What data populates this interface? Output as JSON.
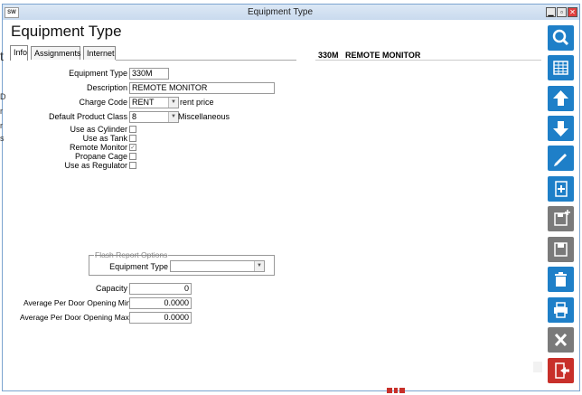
{
  "window": {
    "title": "Equipment Type",
    "app_icon": "SW"
  },
  "page": {
    "title": "Equipment Type"
  },
  "tabs": [
    {
      "label": "Info"
    },
    {
      "label": "Assignments"
    },
    {
      "label": "Internet"
    }
  ],
  "form": {
    "equipment_type": {
      "label": "Equipment Type",
      "value": "330M"
    },
    "description": {
      "label": "Description",
      "value": "REMOTE MONITOR"
    },
    "charge_code": {
      "label": "Charge Code",
      "value": "RENT",
      "extra": "rent price"
    },
    "default_product_class": {
      "label": "Default Product Class",
      "value": "8",
      "extra": "Miscellaneous"
    },
    "use_as_cylinder": {
      "label": "Use as Cylinder",
      "checked": false
    },
    "use_as_tank": {
      "label": "Use as Tank",
      "checked": false
    },
    "remote_monitor": {
      "label": "Remote Monitor",
      "checked": true
    },
    "propane_cage": {
      "label": "Propane Cage",
      "checked": false
    },
    "use_as_regulator": {
      "label": "Use as Regulator",
      "checked": false
    }
  },
  "flash_report": {
    "legend": "Flash Report Options",
    "equipment_type": {
      "label": "Equipment Type",
      "value": ""
    }
  },
  "metrics": {
    "capacity": {
      "label": "Capacity",
      "value": "0"
    },
    "avg_min": {
      "label": "Average Per Door Opening Minimum",
      "value": "0.0000"
    },
    "avg_max": {
      "label": "Average Per Door Opening Maximum",
      "value": "0.0000"
    }
  },
  "detail": {
    "code": "330M",
    "description": "REMOTE MONITOR"
  },
  "toolbar": [
    {
      "icon": "search-icon"
    },
    {
      "icon": "grid-icon"
    },
    {
      "icon": "arrow-up-icon"
    },
    {
      "icon": "arrow-down-icon"
    },
    {
      "icon": "pencil-icon"
    },
    {
      "icon": "new-document-icon"
    },
    {
      "icon": "add-disk-icon"
    },
    {
      "icon": "save-disk-icon"
    },
    {
      "icon": "trash-icon"
    },
    {
      "icon": "printer-icon"
    },
    {
      "icon": "x-icon"
    },
    {
      "icon": "exit-door-icon"
    }
  ],
  "colors": {
    "toolbar_blue": "#1e7fc8",
    "toolbar_gray": "#7a7a7a",
    "toolbar_red": "#c8302a",
    "title_bar": "#c9daee"
  },
  "left_fragments": {
    "f1": "t",
    "f2": "D",
    "f3": "r",
    "f4": "r",
    "f5": "s"
  }
}
